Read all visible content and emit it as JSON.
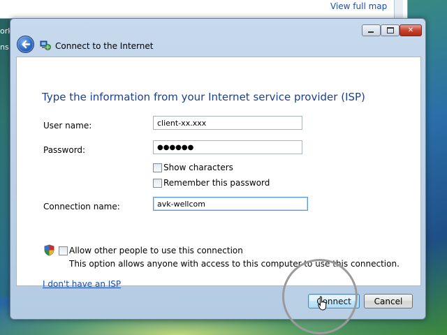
{
  "background": {
    "map_link": "View full map",
    "side_text_1": "ork",
    "side_text_2": "ns"
  },
  "dialog": {
    "title": "Connect to the Internet",
    "window_controls": {
      "minimize": "minimize-icon",
      "maximize": "maximize-icon",
      "close": "close-icon"
    },
    "heading": "Type the information from your Internet service provider (ISP)",
    "fields": {
      "user_name": {
        "label": "User name:",
        "value": "client-xx.xxx"
      },
      "password": {
        "label": "Password:",
        "value": "●●●●●●"
      },
      "connection_name": {
        "label": "Connection name:",
        "value": "avk-wellcom"
      }
    },
    "checkboxes": {
      "show_characters": {
        "label": "Show characters",
        "checked": false
      },
      "remember_password": {
        "label": "Remember this password",
        "checked": false
      },
      "allow_others": {
        "label": "Allow other people to use this connection",
        "checked": false
      }
    },
    "allow_description": "This option allows anyone with access to this computer to use this connection.",
    "no_isp_link": "I don't have an ISP",
    "buttons": {
      "connect": "Connect",
      "cancel": "Cancel"
    }
  },
  "colors": {
    "heading": "#1c3f8f",
    "link": "#1a4ea8",
    "close_button": "#c9432f"
  }
}
